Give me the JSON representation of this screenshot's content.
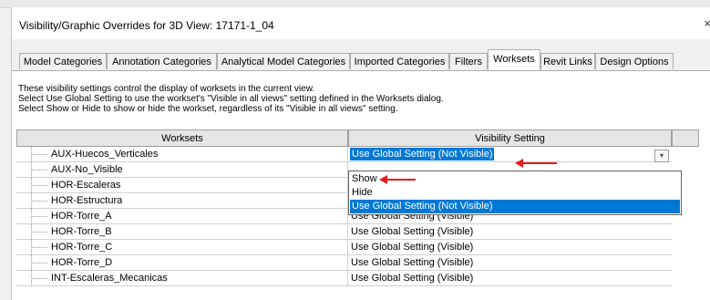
{
  "dialog": {
    "title": "Visibility/Graphic Overrides for 3D View: 17171-1_04",
    "close_glyph": "×"
  },
  "tabs": [
    {
      "label": "Model Categories",
      "active": false
    },
    {
      "label": "Annotation Categories",
      "active": false
    },
    {
      "label": "Analytical Model Categories",
      "active": false
    },
    {
      "label": "Imported Categories",
      "active": false
    },
    {
      "label": "Filters",
      "active": false
    },
    {
      "label": "Worksets",
      "active": true
    },
    {
      "label": "Revit Links",
      "active": false
    },
    {
      "label": "Design Options",
      "active": false
    }
  ],
  "description": [
    "These visibility settings control the display of worksets in the current view.",
    "Select Use Global Setting to use the workset's \"Visible in all views\" setting defined in the Worksets dialog.",
    "Select Show or Hide to show or hide the workset, regardless of its \"Visible in all views\" setting."
  ],
  "table": {
    "headers": {
      "worksets": "Worksets",
      "visibility": "Visibility Setting"
    },
    "rows": [
      {
        "name": "AUX-Huecos_Verticales",
        "visibility": "Use Global Setting (Not Visible)",
        "editing": true
      },
      {
        "name": "AUX-No_Visible",
        "visibility": ""
      },
      {
        "name": "HOR-Escaleras",
        "visibility": ""
      },
      {
        "name": "HOR-Estructura",
        "visibility": ""
      },
      {
        "name": "HOR-Torre_A",
        "visibility": "Use Global Setting (Visible)"
      },
      {
        "name": "HOR-Torre_B",
        "visibility": "Use Global Setting (Visible)"
      },
      {
        "name": "HOR-Torre_C",
        "visibility": "Use Global Setting (Visible)"
      },
      {
        "name": "HOR-Torre_D",
        "visibility": "Use Global Setting (Visible)"
      },
      {
        "name": "INT-Escaleras_Mecanicas",
        "visibility": "Use Global Setting (Visible)"
      }
    ]
  },
  "dropdown": {
    "options": [
      "Show",
      "Hide",
      "Use Global Setting (Not Visible)"
    ],
    "highlighted_index": 2,
    "button_glyph": "▾"
  },
  "colors": {
    "selection": "#0078d7",
    "annotation_arrow": "#e11d1d"
  }
}
